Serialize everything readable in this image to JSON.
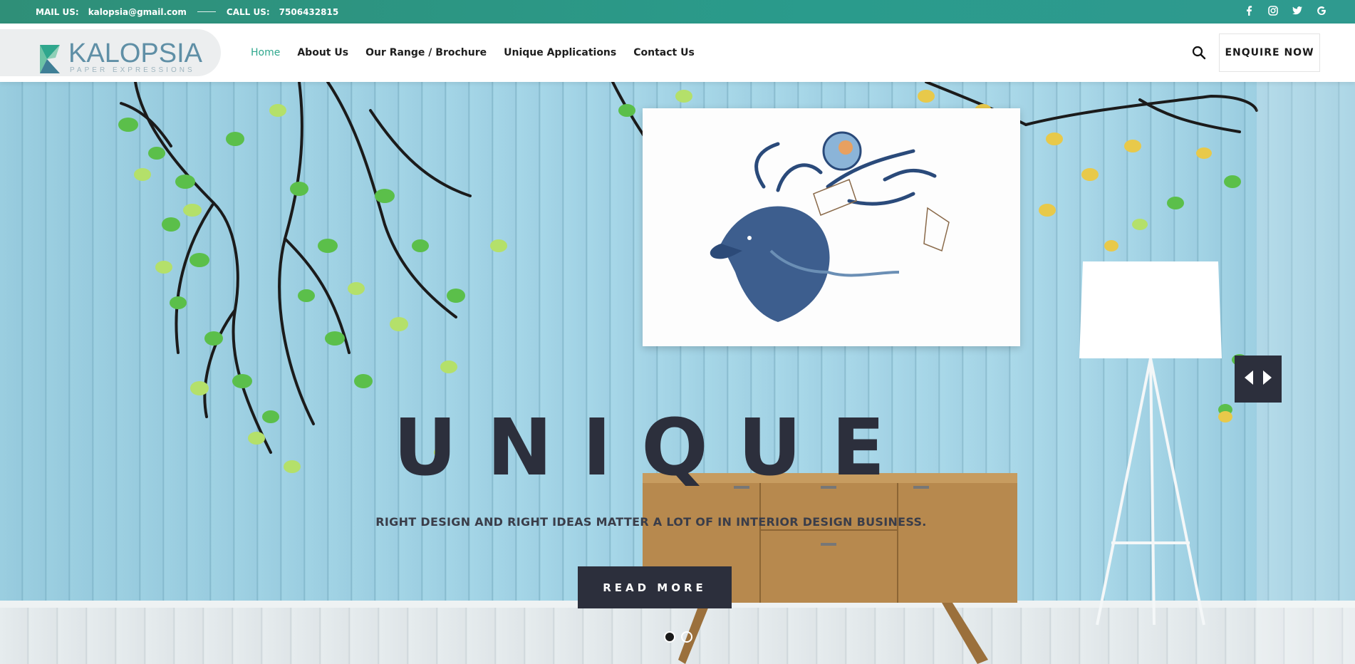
{
  "topbar": {
    "mail_label": "MAIL US:",
    "mail_value": "kalopsia@gmail.com",
    "call_label": "CALL US:",
    "call_value": "7506432815",
    "social_icons": [
      "facebook-icon",
      "instagram-icon",
      "twitter-icon",
      "google-icon"
    ]
  },
  "header": {
    "logo_text": "KALOPSIA",
    "logo_tagline": "PAPER EXPRESSIONS",
    "nav": [
      {
        "label": "Home",
        "active": true
      },
      {
        "label": "About Us",
        "active": false
      },
      {
        "label": "Our Range / Brochure",
        "active": false
      },
      {
        "label": "Unique Applications",
        "active": false
      },
      {
        "label": "Contact Us",
        "active": false
      }
    ],
    "search_icon": "search-icon",
    "enquire_label": "ENQUIRE NOW"
  },
  "hero": {
    "headline": "UNIQUE",
    "subline": "RIGHT DESIGN AND RIGHT IDEAS MATTER A LOT OF IN INTERIOR DESIGN BUSINESS.",
    "cta_label": "READ MORE",
    "slides_total": 2,
    "active_slide": 1
  },
  "colors": {
    "topbar": "#2a9b8c",
    "accent": "#2fa78d",
    "dark": "#2c2f3c",
    "wall": "#a3d4e6"
  }
}
